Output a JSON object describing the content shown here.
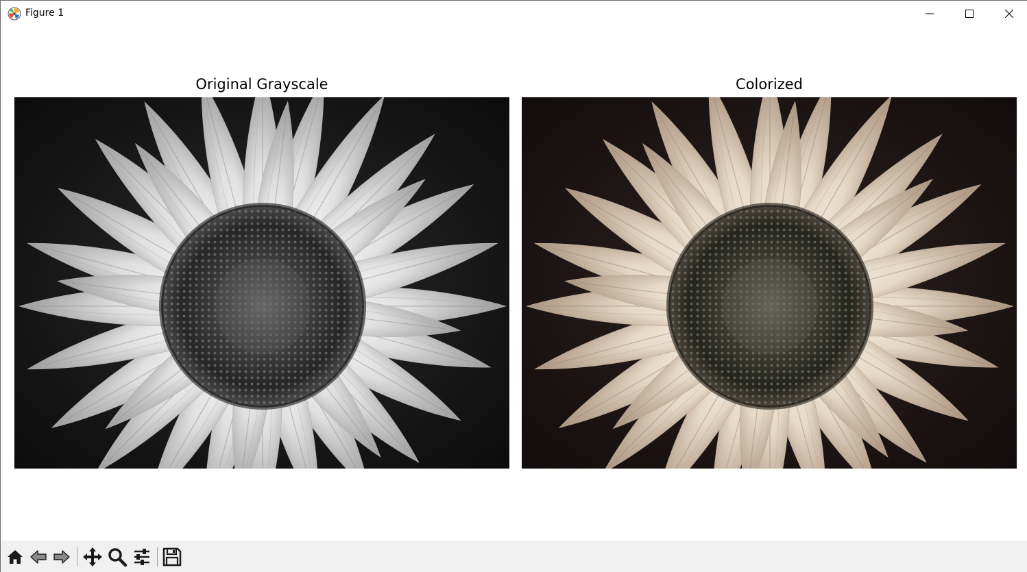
{
  "window": {
    "title": "Figure 1",
    "app_icon": "matplotlib-icon",
    "controls": [
      "minimize-icon",
      "maximize-icon",
      "close-icon"
    ]
  },
  "figure": {
    "axes": [
      {
        "title": "Original Grayscale",
        "image": "sunflower-grayscale-photo"
      },
      {
        "title": "Colorized",
        "image": "sunflower-sepia-colorized-photo"
      }
    ]
  },
  "toolbar": {
    "buttons": [
      "home-icon",
      "back-arrow-icon",
      "forward-arrow-icon",
      "pan-move-icon",
      "zoom-magnifier-icon",
      "configure-subplots-icon",
      "save-floppy-icon"
    ]
  },
  "colors": {
    "toolbar_bg": "#f0f0f0",
    "icon": "#1a1a1a",
    "disabled_icon": "#8a8a8a",
    "sepia_petal": "#e6d8c6",
    "gray_petal": "#d8d8d8"
  }
}
